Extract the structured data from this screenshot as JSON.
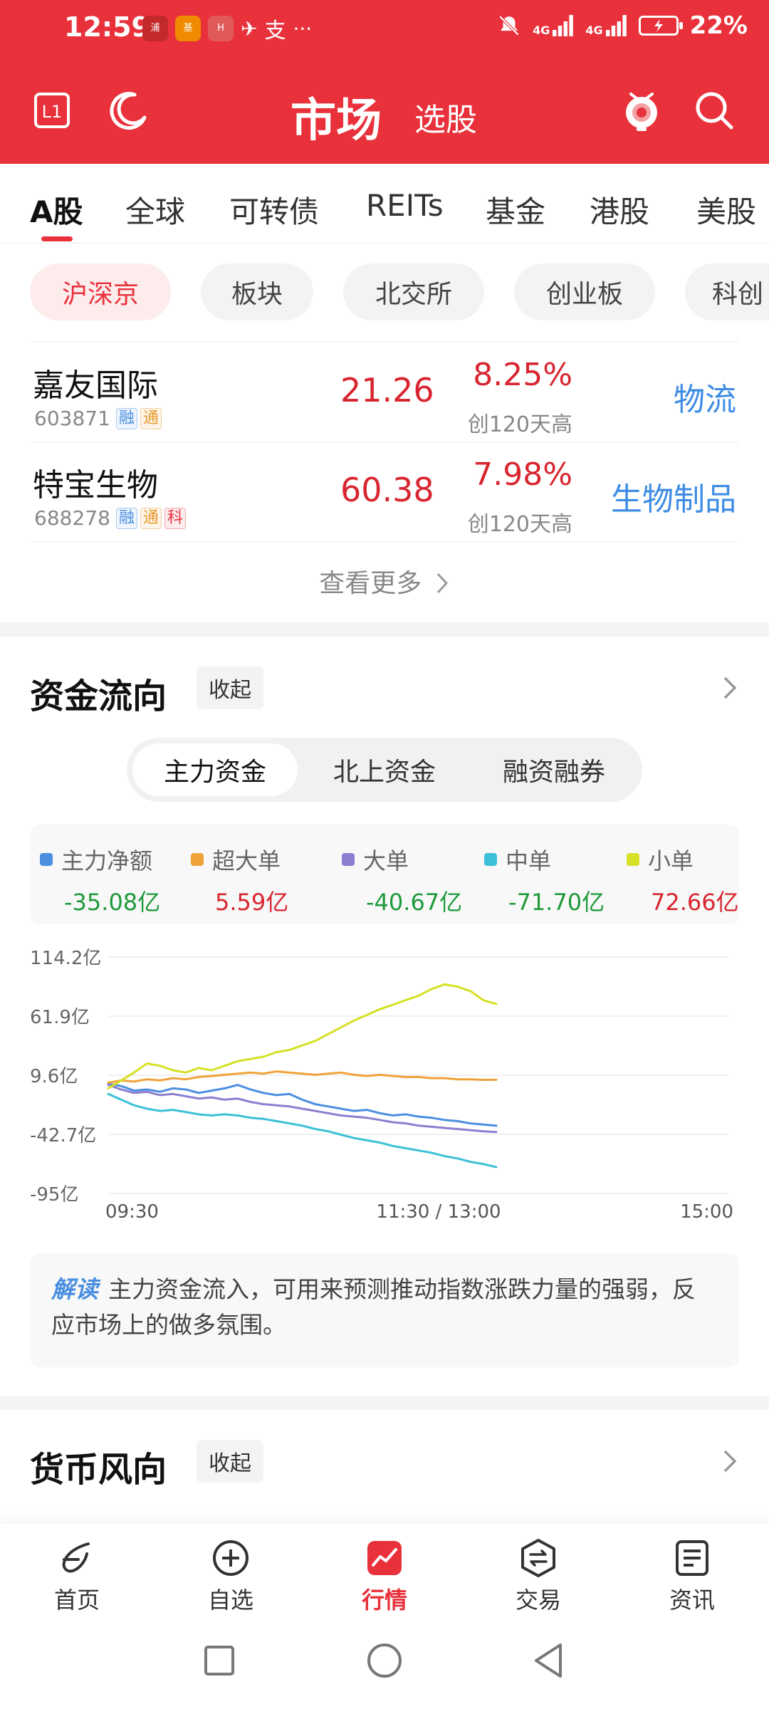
{
  "status_bar": {
    "time": "12:59",
    "battery": "22%",
    "signal_1": "4G",
    "signal_2": "4G",
    "apps": [
      {
        "label": "浦大\n喜奔",
        "color": "#c22a2a"
      },
      {
        "label": "基金",
        "color": "#f08a00"
      },
      {
        "label": "HUAWEI",
        "color": "#e05a5a"
      }
    ]
  },
  "header": {
    "title": "市场",
    "subtitle": "选股",
    "left_badge": "L1"
  },
  "category_tabs": [
    "A股",
    "全球",
    "可转债",
    "REITs",
    "基金",
    "港股",
    "美股"
  ],
  "sub_tabs": [
    "沪深京",
    "板块",
    "北交所",
    "创业板",
    "科创"
  ],
  "stocks": [
    {
      "name": "嘉友国际",
      "code": "603871",
      "tags": [
        "融",
        "通"
      ],
      "price": "21.26",
      "pct": "8.25%",
      "note": "创120天高",
      "sector": "物流"
    },
    {
      "name": "特宝生物",
      "code": "688278",
      "tags": [
        "融",
        "通",
        "科"
      ],
      "price": "60.38",
      "pct": "7.98%",
      "note": "创120天高",
      "sector": "生物制品"
    }
  ],
  "see_more": "查看更多",
  "fund_flow": {
    "title": "资金流向",
    "collapse_label": "收起",
    "segments": [
      "主力资金",
      "北上资金",
      "融资融券"
    ],
    "legend": [
      {
        "name": "主力净额",
        "value": "-35.08亿",
        "color": "#4a8fe0",
        "sign": "neg"
      },
      {
        "name": "超大单",
        "value": "5.59亿",
        "color": "#f0a23a",
        "sign": "pos"
      },
      {
        "name": "大单",
        "value": "-40.67亿",
        "color": "#8a7fd0",
        "sign": "neg"
      },
      {
        "name": "中单",
        "value": "-71.70亿",
        "color": "#3cc0d8",
        "sign": "neg"
      },
      {
        "name": "小单",
        "value": "72.66亿",
        "color": "#d6e024",
        "sign": "pos"
      }
    ],
    "explain_tag": "解读",
    "explain_text": "主力资金流入，可用来预测推动指数涨跌力量的强弱，反应市场上的做多氛围。"
  },
  "chart_data": {
    "type": "line",
    "y_tick_labels": [
      "114.2亿",
      "61.9亿",
      "9.6亿",
      "-42.7亿",
      "-95亿"
    ],
    "y_ticks": [
      114.2,
      61.9,
      9.6,
      -42.7,
      -95
    ],
    "ylim": [
      -95,
      114.2
    ],
    "x_tick_labels": [
      "09:30",
      "11:30 / 13:00",
      "15:00"
    ],
    "x_total_minutes": 240,
    "x": [
      0,
      5,
      10,
      15,
      20,
      25,
      30,
      35,
      40,
      45,
      50,
      55,
      60,
      65,
      70,
      75,
      80,
      85,
      90,
      95,
      100,
      105,
      110,
      115,
      120,
      125,
      130,
      135,
      140,
      145,
      150
    ],
    "series": [
      {
        "name": "主力净额",
        "color": "#4a8fe0",
        "values": [
          2,
          0,
          -4,
          -3,
          -5,
          -2,
          -3,
          -6,
          -4,
          -2,
          1,
          -3,
          -6,
          -8,
          -7,
          -12,
          -16,
          -18,
          -20,
          -22,
          -21,
          -24,
          -26,
          -25,
          -27,
          -28,
          -30,
          -31,
          -33,
          -34,
          -35.08
        ]
      },
      {
        "name": "超大单",
        "color": "#f0a23a",
        "values": [
          3,
          5,
          4,
          6,
          5,
          7,
          6,
          8,
          9,
          10,
          11,
          12,
          11,
          13,
          12,
          11,
          10,
          11,
          12,
          10,
          9,
          10,
          9,
          8,
          8,
          7,
          7,
          6,
          6,
          5.5,
          5.59
        ]
      },
      {
        "name": "大单",
        "color": "#8a7fd0",
        "values": [
          1,
          -3,
          -6,
          -5,
          -8,
          -7,
          -9,
          -11,
          -10,
          -12,
          -11,
          -14,
          -16,
          -17,
          -18,
          -20,
          -22,
          -24,
          -26,
          -27,
          -28,
          -30,
          -32,
          -33,
          -35,
          -36,
          -37,
          -38,
          -39,
          -40,
          -40.67
        ]
      },
      {
        "name": "中单",
        "color": "#3cc0d8",
        "values": [
          -7,
          -12,
          -17,
          -20,
          -22,
          -21,
          -23,
          -25,
          -26,
          -25,
          -26,
          -28,
          -29,
          -31,
          -33,
          -35,
          -38,
          -40,
          -43,
          -46,
          -48,
          -50,
          -53,
          -55,
          -57,
          -59,
          -62,
          -64,
          -67,
          -69,
          -71.7
        ]
      },
      {
        "name": "小单",
        "color": "#d6e024",
        "values": [
          -2,
          5,
          12,
          20,
          18,
          14,
          12,
          16,
          14,
          18,
          22,
          24,
          26,
          30,
          32,
          36,
          40,
          46,
          52,
          58,
          63,
          68,
          72,
          76,
          80,
          86,
          90,
          88,
          84,
          76,
          72.66
        ]
      }
    ],
    "grid": true
  },
  "currency": {
    "title": "货币风向",
    "collapse_label": "收起"
  },
  "bottom_nav": [
    {
      "label": "首页",
      "icon": "home-bolt-icon"
    },
    {
      "label": "自选",
      "icon": "plus-circle-icon"
    },
    {
      "label": "行情",
      "icon": "market-chart-icon"
    },
    {
      "label": "交易",
      "icon": "exchange-icon"
    },
    {
      "label": "资讯",
      "icon": "news-icon"
    }
  ]
}
